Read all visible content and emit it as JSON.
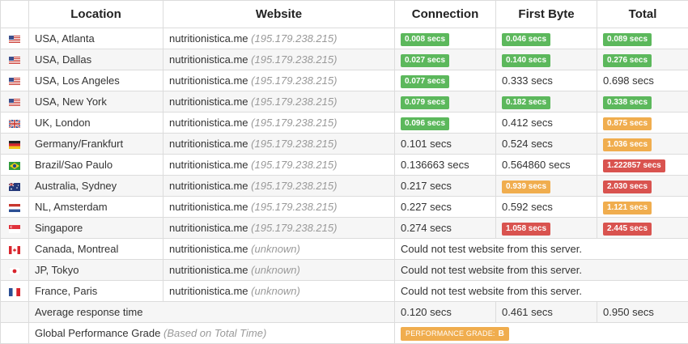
{
  "headers": {
    "location": "Location",
    "website": "Website",
    "connection": "Connection",
    "first_byte": "First Byte",
    "total": "Total"
  },
  "rows": [
    {
      "flag": "us-flag-icon",
      "location": "USA, Atlanta",
      "site": "nutritionistica.me",
      "ip": "(195.179.238.215)",
      "conn": "0.008 secs",
      "conn_c": "g",
      "fb": "0.046 secs",
      "fb_c": "g",
      "tot": "0.089 secs",
      "tot_c": "g"
    },
    {
      "flag": "us-flag-icon",
      "location": "USA, Dallas",
      "site": "nutritionistica.me",
      "ip": "(195.179.238.215)",
      "conn": "0.027 secs",
      "conn_c": "g",
      "fb": "0.140 secs",
      "fb_c": "g",
      "tot": "0.276 secs",
      "tot_c": "g"
    },
    {
      "flag": "us-flag-icon",
      "location": "USA, Los Angeles",
      "site": "nutritionistica.me",
      "ip": "(195.179.238.215)",
      "conn": "0.077 secs",
      "conn_c": "g",
      "fb": "0.333 secs",
      "fb_c": "",
      "tot": "0.698 secs",
      "tot_c": ""
    },
    {
      "flag": "us-flag-icon",
      "location": "USA, New York",
      "site": "nutritionistica.me",
      "ip": "(195.179.238.215)",
      "conn": "0.079 secs",
      "conn_c": "g",
      "fb": "0.182 secs",
      "fb_c": "g",
      "tot": "0.338 secs",
      "tot_c": "g"
    },
    {
      "flag": "uk-flag-icon",
      "location": "UK, London",
      "site": "nutritionistica.me",
      "ip": "(195.179.238.215)",
      "conn": "0.096 secs",
      "conn_c": "g",
      "fb": "0.412 secs",
      "fb_c": "",
      "tot": "0.875 secs",
      "tot_c": "o"
    },
    {
      "flag": "germany-flag-icon",
      "location": "Germany/Frankfurt",
      "site": "nutritionistica.me",
      "ip": "(195.179.238.215)",
      "conn": "0.101 secs",
      "conn_c": "",
      "fb": "0.524 secs",
      "fb_c": "",
      "tot": "1.036 secs",
      "tot_c": "o"
    },
    {
      "flag": "brazil-flag-icon",
      "location": "Brazil/Sao Paulo",
      "site": "nutritionistica.me",
      "ip": "(195.179.238.215)",
      "conn": "0.136663 secs",
      "conn_c": "",
      "fb": "0.564860 secs",
      "fb_c": "",
      "tot": "1.222857 secs",
      "tot_c": "r"
    },
    {
      "flag": "australia-flag-icon",
      "location": "Australia, Sydney",
      "site": "nutritionistica.me",
      "ip": "(195.179.238.215)",
      "conn": "0.217 secs",
      "conn_c": "",
      "fb": "0.939 secs",
      "fb_c": "o",
      "tot": "2.030 secs",
      "tot_c": "r"
    },
    {
      "flag": "netherlands-flag-icon",
      "location": "NL, Amsterdam",
      "site": "nutritionistica.me",
      "ip": "(195.179.238.215)",
      "conn": "0.227 secs",
      "conn_c": "",
      "fb": "0.592 secs",
      "fb_c": "",
      "tot": "1.121 secs",
      "tot_c": "o"
    },
    {
      "flag": "singapore-flag-icon",
      "location": "Singapore",
      "site": "nutritionistica.me",
      "ip": "(195.179.238.215)",
      "conn": "0.274 secs",
      "conn_c": "",
      "fb": "1.058 secs",
      "fb_c": "r",
      "tot": "2.445 secs",
      "tot_c": "r"
    }
  ],
  "failed_rows": [
    {
      "flag": "canada-flag-icon",
      "location": "Canada, Montreal",
      "site": "nutritionistica.me",
      "ip": "(unknown)",
      "msg": "Could not test website from this server."
    },
    {
      "flag": "japan-flag-icon",
      "location": "JP, Tokyo",
      "site": "nutritionistica.me",
      "ip": "(unknown)",
      "msg": "Could not test website from this server."
    },
    {
      "flag": "france-flag-icon",
      "location": "France, Paris",
      "site": "nutritionistica.me",
      "ip": "(unknown)",
      "msg": "Could not test website from this server."
    }
  ],
  "average": {
    "label": "Average response time",
    "conn": "0.120 secs",
    "fb": "0.461 secs",
    "tot": "0.950 secs"
  },
  "grade": {
    "label": "Global Performance Grade",
    "note": "(Based on Total Time)",
    "badge_label": "PERFORMANCE GRADE:",
    "badge_value": "B"
  },
  "colors": {
    "good": "#5cb85c",
    "warn": "#f0ad4e",
    "bad": "#d9534f"
  }
}
